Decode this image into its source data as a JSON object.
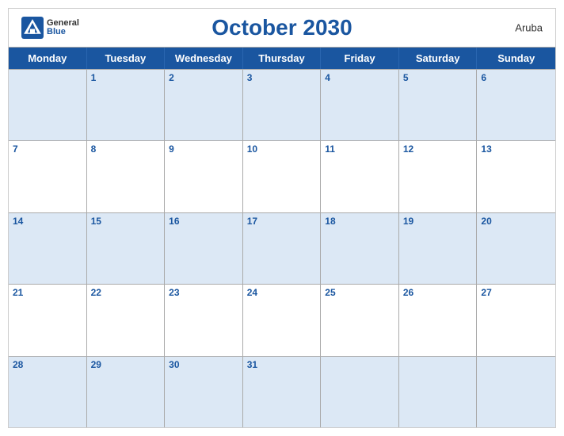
{
  "header": {
    "title": "October 2030",
    "location": "Aruba",
    "logo": {
      "general": "General",
      "blue": "Blue"
    }
  },
  "days_of_week": [
    "Monday",
    "Tuesday",
    "Wednesday",
    "Thursday",
    "Friday",
    "Saturday",
    "Sunday"
  ],
  "weeks": [
    [
      {
        "date": "",
        "empty": true
      },
      {
        "date": "1"
      },
      {
        "date": "2"
      },
      {
        "date": "3"
      },
      {
        "date": "4"
      },
      {
        "date": "5"
      },
      {
        "date": "6"
      }
    ],
    [
      {
        "date": "7"
      },
      {
        "date": "8"
      },
      {
        "date": "9"
      },
      {
        "date": "10"
      },
      {
        "date": "11"
      },
      {
        "date": "12"
      },
      {
        "date": "13"
      }
    ],
    [
      {
        "date": "14"
      },
      {
        "date": "15"
      },
      {
        "date": "16"
      },
      {
        "date": "17"
      },
      {
        "date": "18"
      },
      {
        "date": "19"
      },
      {
        "date": "20"
      }
    ],
    [
      {
        "date": "21"
      },
      {
        "date": "22"
      },
      {
        "date": "23"
      },
      {
        "date": "24"
      },
      {
        "date": "25"
      },
      {
        "date": "26"
      },
      {
        "date": "27"
      }
    ],
    [
      {
        "date": "28"
      },
      {
        "date": "29"
      },
      {
        "date": "30"
      },
      {
        "date": "31"
      },
      {
        "date": "",
        "empty": true
      },
      {
        "date": "",
        "empty": true
      },
      {
        "date": "",
        "empty": true
      }
    ]
  ],
  "colors": {
    "primary": "#1a56a0",
    "header_bg": "#1a56a0",
    "odd_row_bg": "#dce8f5",
    "even_row_bg": "#ffffff"
  }
}
